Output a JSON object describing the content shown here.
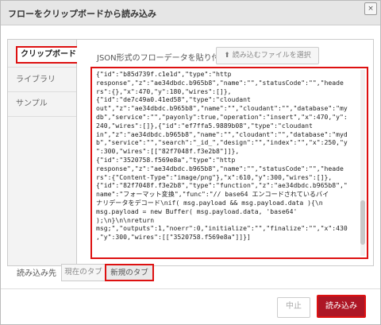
{
  "dialog": {
    "title": "フローをクリップボードから読み込み",
    "close_icon": "×"
  },
  "tabs": [
    {
      "label": "クリップボード"
    },
    {
      "label": "ライブラリ"
    },
    {
      "label": "サンプル"
    }
  ],
  "clipboard": {
    "instruction": "JSON形式のフローデータを貼り付け",
    "select_file_label": "読み込むファイルを選択",
    "code_lines": [
      "{\"id\":\"b85d739f.c1e1d\",\"type\":\"http",
      "response\",\"z\":\"ae34dbdc.b965b8\",\"name\":\"\",\"statusCode\":\"\",\"heade",
      "rs\":{},\"x\":470,\"y\":180,\"wires\":[]},",
      "{\"id\":\"de7c49a0.41ed58\",\"type\":\"cloudant",
      "out\",\"z\":\"ae34dbdc.b965b8\",\"name\":\"\",\"cloudant\":\"\",\"database\":\"my",
      "db\",\"service\":\"\",\"payonly\":true,\"operation\":\"insert\",\"x\":470,\"y\":",
      "240,\"wires\":[]},{\"id\":\"ef7ffa5.9889b08\",\"type\":\"cloudant",
      "in\",\"z\":\"ae34dbdc.b965b8\",\"name\":\"\",\"cloudant\":\"\",\"database\":\"myd",
      "b\",\"service\":\"\",\"search\":\"_id_\",\"design\":\"\",\"index\":\"\",\"x\":250,\"y",
      "\":300,\"wires\":[[\"82f7048f.f3e2b8\"]]},",
      "{\"id\":\"3520758.f569e8a\",\"type\":\"http",
      "response\",\"z\":\"ae34dbdc.b965b8\",\"name\":\"\",\"statusCode\":\"\",\"heade",
      "rs\":{\"Content-Type\":\"image/png\"},\"x\":610,\"y\":300,\"wires\":[]},",
      "{\"id\":\"82f7048f.f3e2b8\",\"type\":\"function\",\"z\":\"ae34dbdc.b965b8\",\"",
      "name\":\"フォーマット変換\",\"func\":\"// base64 エンコードされているバイ",
      "ナリデータをデコード\\nif( msg.payload && msg.payload.data ){\\n",
      "msg.payload = new Buffer( msg.payload.data, 'base64'",
      ");\\n}\\n\\nreturn",
      "msg;\",\"outputs\":1,\"noerr\":0,\"initialize\":\"\",\"finalize\":\"\",\"x\":430",
      ",\"y\":300,\"wires\":[[\"3520758.f569e8a\"]]}]"
    ]
  },
  "import_target": {
    "label": "読み込み先",
    "current_tab": "現在のタブ",
    "new_tab": "新規のタブ"
  },
  "footer": {
    "cancel": "中止",
    "import": "読み込み"
  },
  "colors": {
    "highlight": "#dd1111",
    "primary_button": "#ad1625"
  },
  "icons": {
    "upload": "upload-icon"
  }
}
